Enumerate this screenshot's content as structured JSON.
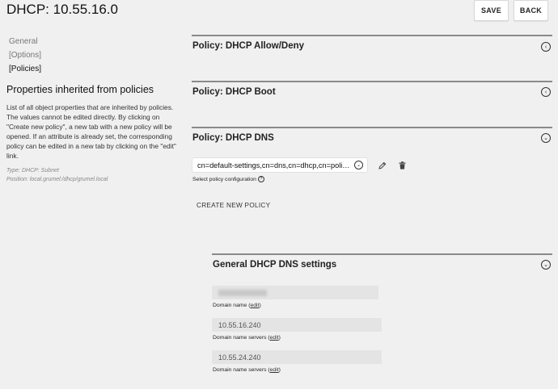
{
  "header": {
    "title": "DHCP: 10.55.16.0",
    "save_label": "SAVE",
    "back_label": "BACK"
  },
  "sidebar": {
    "nav": [
      {
        "label": "General",
        "active": false
      },
      {
        "label": "[Options]",
        "active": false
      },
      {
        "label": "[Policies]",
        "active": true
      }
    ],
    "heading": "Properties inherited from policies",
    "description": "List of all object properties that are inherited by policies. The values cannot be edited directly. By clicking on \"Create new policy\", a new tab with a new policy will be opened. If an attribute is already set, the corresponding policy can be edited in a new tab by clicking on the \"edit\" link.",
    "type_label": "Type:",
    "type_value": "DHCP: Subnet",
    "position_label": "Position:",
    "position_value": "local.grumel:/dhcp/grumel.local"
  },
  "sections": [
    {
      "title": "Policy: DHCP Allow/Deny",
      "state": "collapsed"
    },
    {
      "title": "Policy: DHCP Boot",
      "state": "collapsed"
    },
    {
      "title": "Policy: DHCP DNS",
      "state": "expanded"
    }
  ],
  "dns_policy": {
    "selected_value": "cn=default-settings,cn=dns,cn=dhcp,cn=policies,dc=grumel,dc=local",
    "select_label": "Select policy configuration",
    "info_icon": "help-circle-icon",
    "edit_icon": "pencil-icon",
    "delete_icon": "trash-icon",
    "create_label": "CREATE NEW POLICY"
  },
  "general_settings": {
    "title": "General DHCP DNS settings",
    "edit_link": "edit",
    "fields": [
      {
        "value": "",
        "label": "Domain name",
        "blurred": true
      },
      {
        "value": "10.55.16.240",
        "label": "Domain name servers"
      },
      {
        "value": "10.55.24.240",
        "label": "Domain name servers"
      }
    ]
  },
  "colors": {
    "background": "#f0f0f0",
    "divider": "#8a8a8a",
    "field_bg": "#e4e4e4"
  }
}
